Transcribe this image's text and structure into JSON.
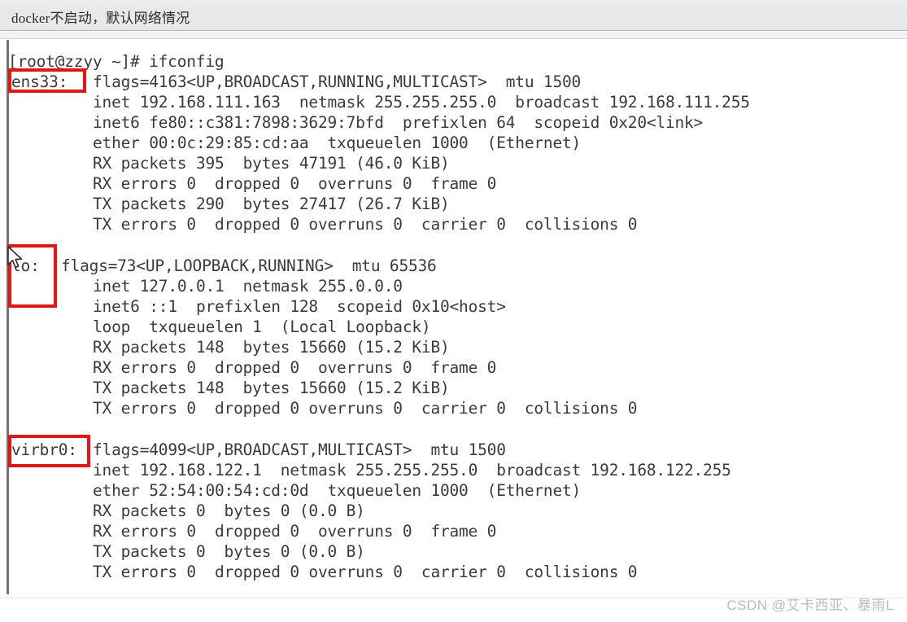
{
  "window": {
    "title": "docker不启动，默认网络情况"
  },
  "terminal": {
    "prompt_line": "[root@zzyy ~]# ifconfig",
    "interfaces": [
      {
        "name": "ens33:",
        "header_rest": "flags=4163<UP,BROADCAST,RUNNING,MULTICAST>  mtu 1500",
        "lines": [
          "inet 192.168.111.163  netmask 255.255.255.0  broadcast 192.168.111.255",
          "inet6 fe80::c381:7898:3629:7bfd  prefixlen 64  scopeid 0x20<link>",
          "ether 00:0c:29:85:cd:aa  txqueuelen 1000  (Ethernet)",
          "RX packets 395  bytes 47191 (46.0 KiB)",
          "RX errors 0  dropped 0  overruns 0  frame 0",
          "TX packets 290  bytes 27417 (26.7 KiB)",
          "TX errors 0  dropped 0 overruns 0  carrier 0  collisions 0"
        ]
      },
      {
        "name": "lo:",
        "header_rest": "flags=73<UP,LOOPBACK,RUNNING>  mtu 65536",
        "lines": [
          "inet 127.0.0.1  netmask 255.0.0.0",
          "inet6 ::1  prefixlen 128  scopeid 0x10<host>",
          "loop  txqueuelen 1  (Local Loopback)",
          "RX packets 148  bytes 15660 (15.2 KiB)",
          "RX errors 0  dropped 0  overruns 0  frame 0",
          "TX packets 148  bytes 15660 (15.2 KiB)",
          "TX errors 0  dropped 0 overruns 0  carrier 0  collisions 0"
        ]
      },
      {
        "name": "virbr0:",
        "header_rest": "flags=4099<UP,BROADCAST,MULTICAST>  mtu 1500",
        "lines": [
          "inet 192.168.122.1  netmask 255.255.255.0  broadcast 192.168.122.255",
          "ether 52:54:00:54:cd:0d  txqueuelen 1000  (Ethernet)",
          "RX packets 0  bytes 0 (0.0 B)",
          "RX errors 0  dropped 0  overruns 0  frame 0",
          "TX packets 0  bytes 0 (0.0 B)",
          "TX errors 0  dropped 0 overruns 0  carrier 0  collisions 0"
        ]
      }
    ]
  },
  "annotations": {
    "highlight_color": "#ee1111",
    "boxes": [
      {
        "target": "ens33"
      },
      {
        "target": "lo"
      },
      {
        "target": "virbr0"
      }
    ]
  },
  "cursor": {
    "kind": "arrow-pointer"
  },
  "watermark": {
    "text": "CSDN @艾卡西亚、暴雨L"
  }
}
